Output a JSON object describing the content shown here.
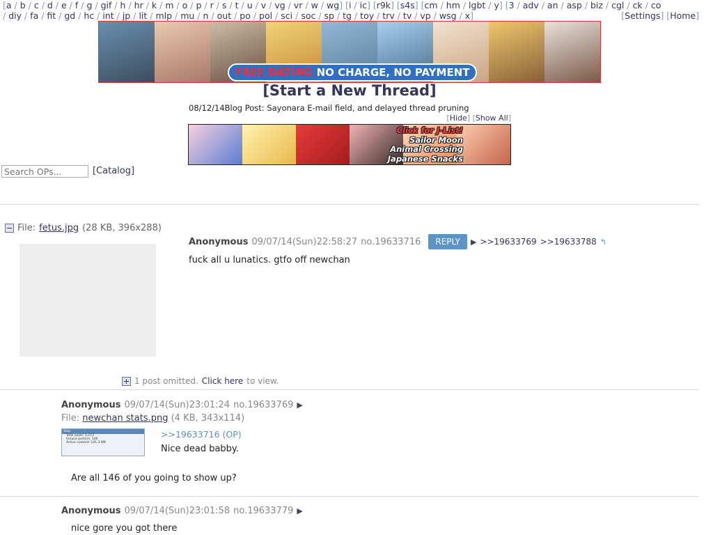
{
  "nav": {
    "row1": [
      "a",
      "b",
      "c",
      "d",
      "e",
      "f",
      "g",
      "gif",
      "h",
      "hr",
      "k",
      "m",
      "o",
      "p",
      "r",
      "s",
      "t",
      "u",
      "v",
      "vg",
      "vr",
      "w",
      "wg"
    ],
    "row1_group2": [
      "i",
      "ic"
    ],
    "row1_group3": [
      "r9k"
    ],
    "row1_group4": [
      "s4s"
    ],
    "row1_group5": [
      "cm",
      "hm",
      "lgbt",
      "y"
    ],
    "row1_group6": [
      "3",
      "adv",
      "an",
      "asp",
      "biz",
      "cgl",
      "ck",
      "co"
    ],
    "row2": [
      "diy",
      "fa",
      "fit",
      "gd",
      "hc",
      "int",
      "jp",
      "lit",
      "mlp",
      "mu",
      "n",
      "out",
      "po",
      "pol",
      "sci",
      "soc",
      "sp",
      "tg",
      "toy",
      "trv",
      "tv",
      "vp",
      "wsg",
      "x"
    ],
    "settings": "Settings",
    "home": "Home"
  },
  "ad_top": {
    "banner_red": "FREE DATING",
    "banner_white": "NO CHARGE, NO PAYMENT"
  },
  "start_thread": "[Start a New Thread]",
  "blog_post": "08/12/14Blog Post: Sayonara E-mail field, and delayed thread pruning",
  "hide": "Hide",
  "show_all": "Show All",
  "ad_jlist": {
    "line1": "Click for J-List!",
    "line2": "Sailor Moon",
    "line3": "Animal Crossing",
    "line4": "Japanese Snacks"
  },
  "search": {
    "placeholder": "Search OPs..."
  },
  "catalog": "[Catalog]",
  "op": {
    "file_label": "File:",
    "file_name": "fetus.jpg",
    "file_meta": "(28 KB, 396x288)",
    "name": "Anonymous",
    "datetime": "09/07/14(Sun)22:58:27",
    "post_no": "no.19633716",
    "reply_button": "REPLY",
    "backlinks": [
      ">>19633769",
      ">>19633788"
    ],
    "message": "fuck all u lunatics. gtfo off newchan"
  },
  "omitted": {
    "text": "1 post omitted.",
    "click_here": "Click here",
    "to_view": "to view."
  },
  "replies": [
    {
      "name": "Anonymous",
      "datetime": "09/07/14(Sun)23:01:24",
      "post_no": "no.19633769",
      "file_label": "File:",
      "file_name": "newchan stats.png",
      "file_meta": "(4 KB, 343x114)",
      "quote_link": ">>19633716 (OP)",
      "message_line1": "Nice dead babby.",
      "message_line2": "Are all 146 of you going to show up?",
      "thumb_title": "Stats",
      "thumb_lines": [
        "Total posts: 1,273",
        "Unique posters: 146",
        "Active content: 141.3 MB"
      ]
    },
    {
      "name": "Anonymous",
      "datetime": "09/07/14(Sun)23:01:58",
      "post_no": "no.19633779",
      "message": "nice gore you got there"
    }
  ],
  "colors": {
    "link": "#34345c",
    "reply_button": "#5d94c6",
    "quote_link": "#5a8fc6"
  }
}
